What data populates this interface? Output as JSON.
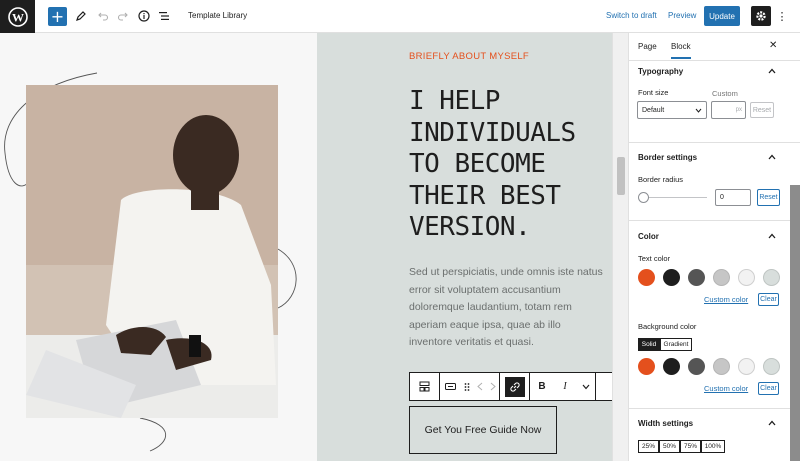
{
  "topbar": {
    "add_label": "+",
    "doc_title": "Template Library",
    "switch_to_draft": "Switch to draft",
    "preview": "Preview",
    "update": "Update",
    "more": "⋮"
  },
  "hero": {
    "eyebrow": "BRIEFLY ABOUT MYSELF",
    "headline_lines": [
      "I HELP",
      "INDIVIDUALS",
      "TO BECOME",
      "THEIR BEST",
      "VERSION."
    ],
    "body": "Sed ut perspiciatis, unde omnis iste natus error sit voluptatem accusantium doloremque laudantium, totam rem aperiam eaque ipsa, quae ab illo inventore veritatis et quasi.",
    "cta": "Get You Free Guide Now"
  },
  "block_toolbar": {
    "bold": "B",
    "italic": "I"
  },
  "sidebar": {
    "tab_page": "Page",
    "tab_block": "Block",
    "close": "✕",
    "typography": {
      "title": "Typography",
      "font_size_label": "Font size",
      "custom_label": "Custom",
      "font_size_value": "Default",
      "custom_unit": "px",
      "reset": "Reset"
    },
    "border": {
      "title": "Border settings",
      "radius_label": "Border radius",
      "radius_value": "0",
      "reset": "Reset",
      "slider_level": 0
    },
    "color": {
      "title": "Color",
      "text_color_label": "Text color",
      "custom_color": "Custom color",
      "clear": "Clear",
      "bg_color_label": "Background color",
      "solid": "Solid",
      "gradient": "Gradient",
      "custom_color_2": "Custom color",
      "clear_2": "Clear",
      "swatches": [
        "#e4501d",
        "#1e1e1e",
        "#555555",
        "#c6c6c6",
        "#f2f2f2",
        "#d8dedc"
      ]
    },
    "width": {
      "title": "Width settings",
      "options": [
        "25%",
        "50%",
        "75%",
        "100%"
      ]
    }
  },
  "colors": {
    "accent": "#2271b1",
    "brand_orange": "#e4501d",
    "hero_bg": "#d8dedc"
  }
}
